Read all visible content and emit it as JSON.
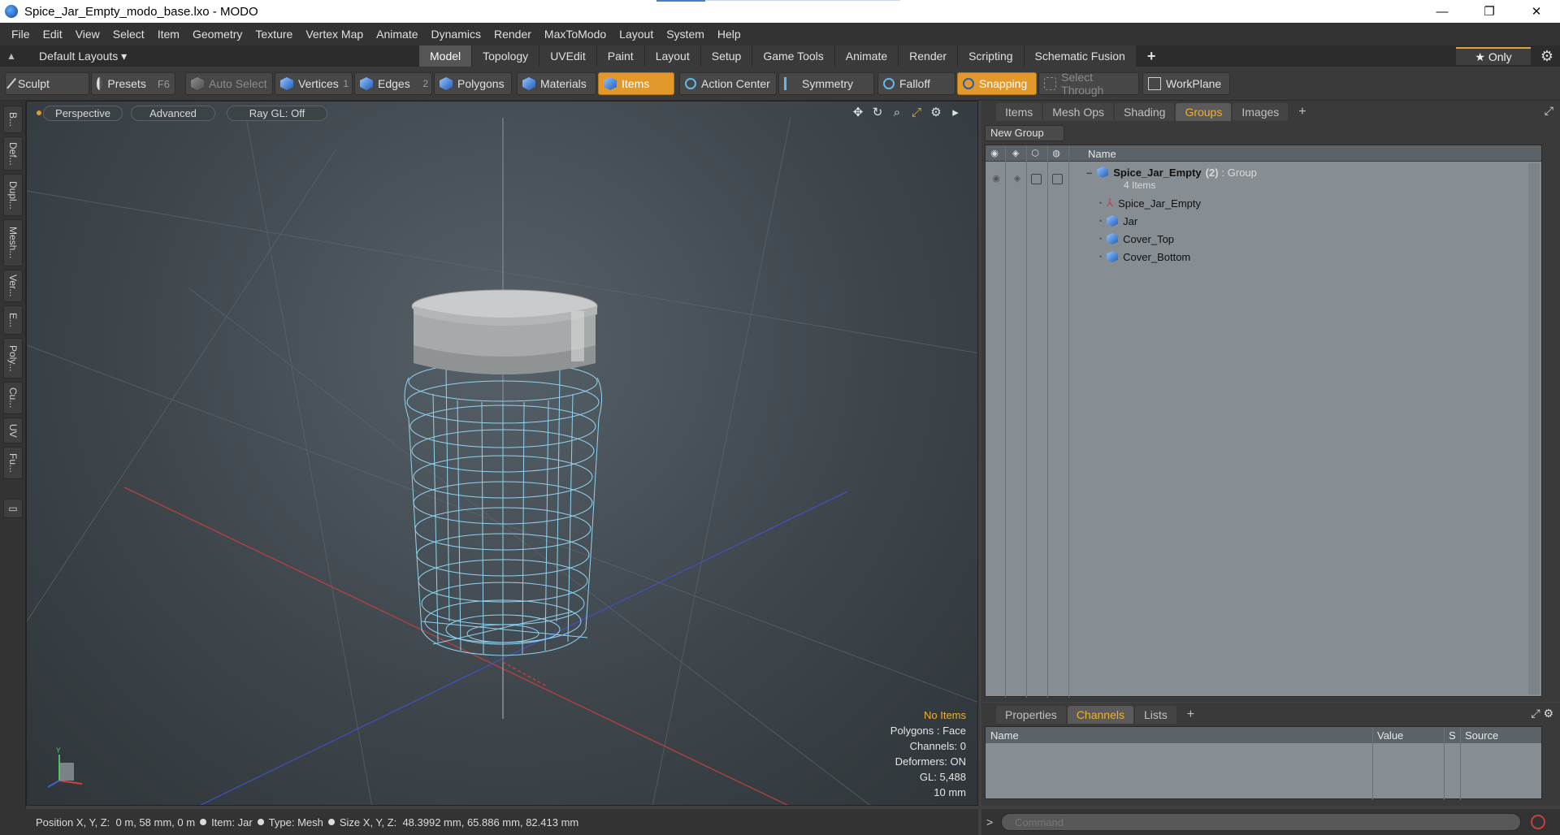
{
  "window": {
    "title": "Spice_Jar_Empty_modo_base.lxo - MODO",
    "minimize": "—",
    "restore": "❐",
    "close": "✕"
  },
  "menu": [
    "File",
    "Edit",
    "View",
    "Select",
    "Item",
    "Geometry",
    "Texture",
    "Vertex Map",
    "Animate",
    "Dynamics",
    "Render",
    "MaxToModo",
    "Layout",
    "System",
    "Help"
  ],
  "layout_bar": {
    "layouts_label": "Default Layouts ▾",
    "tabs": [
      "Model",
      "Topology",
      "UVEdit",
      "Paint",
      "Layout",
      "Setup",
      "Game Tools",
      "Animate",
      "Render",
      "Scripting",
      "Schematic Fusion"
    ],
    "active_tab": "Model",
    "add_tab": "+",
    "only_label": "★  Only"
  },
  "toolbar": {
    "sculpt": "Sculpt",
    "presets": "Presets",
    "presets_key": "F6",
    "auto_select": "Auto Select",
    "vertices": "Vertices",
    "vertices_num": "1",
    "edges": "Edges",
    "edges_num": "2",
    "polygons": "Polygons",
    "materials": "Materials",
    "items": "Items",
    "action_center": "Action Center",
    "symmetry": "Symmetry",
    "falloff": "Falloff",
    "snapping": "Snapping",
    "select_through": "Select Through",
    "workplane": "WorkPlane"
  },
  "left_tabs": [
    "B...",
    "Def...",
    "Dupl...",
    "Mesh...",
    "Ver...",
    "E...",
    "Poly...",
    "Cu...",
    "UV",
    "Fu..."
  ],
  "viewport": {
    "perspective": "Perspective",
    "advanced": "Advanced",
    "raygl": "Ray GL: Off",
    "info": {
      "no_items": "No Items",
      "polygons": "Polygons : Face",
      "channels": "Channels: 0",
      "deformers": "Deformers: ON",
      "gl": "GL: 5,488",
      "scale": "10 mm"
    }
  },
  "groups_panel": {
    "tabs": [
      "Items",
      "Mesh Ops",
      "Shading",
      "Groups",
      "Images"
    ],
    "active_tab": "Groups",
    "add_tab": "+",
    "new_group": "New Group",
    "column_name": "Name",
    "group": {
      "name": "Spice_Jar_Empty",
      "count": "(2)",
      "suffix": ": Group",
      "sub": "4 Items"
    },
    "items": [
      "Spice_Jar_Empty",
      "Jar",
      "Cover_Top",
      "Cover_Bottom"
    ]
  },
  "channels_panel": {
    "tabs": [
      "Properties",
      "Channels",
      "Lists"
    ],
    "active_tab": "Channels",
    "add_tab": "+",
    "columns": {
      "name": "Name",
      "value": "Value",
      "s": "S",
      "source": "Source"
    }
  },
  "command": {
    "placeholder": "Command",
    "arrow": ">"
  },
  "status": {
    "position_label": "Position X, Y, Z:",
    "position_value": "0 m, 58 mm, 0 m",
    "item_label": "Item:",
    "item_value": "Jar",
    "type_label": "Type:",
    "type_value": "Mesh",
    "size_label": "Size X, Y, Z:",
    "size_value": "48.3992 mm, 65.886 mm, 82.413 mm"
  },
  "colors": {
    "accent_orange": "#e2982b",
    "active_tab_text": "#f0b030",
    "wire": "#8fd3f0"
  }
}
